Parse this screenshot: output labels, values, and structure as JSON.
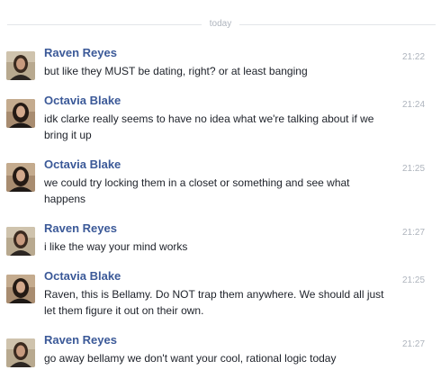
{
  "divider": {
    "label": "today"
  },
  "messages": [
    {
      "sender": "Raven Reyes",
      "avatar": "raven-avatar",
      "time": "21:22",
      "text": "but like they MUST be dating, right? or at least banging"
    },
    {
      "sender": "Octavia Blake",
      "avatar": "octavia-avatar",
      "time": "21:24",
      "text": "idk clarke really seems to have no idea what we're talking about if we bring it up"
    },
    {
      "sender": "Octavia Blake",
      "avatar": "octavia-avatar",
      "time": "21:25",
      "text": "we could try locking them in a closet or something and see what happens"
    },
    {
      "sender": "Raven Reyes",
      "avatar": "raven-avatar",
      "time": "21:27",
      "text": "i like the way your mind works"
    },
    {
      "sender": "Octavia Blake",
      "avatar": "octavia-avatar",
      "time": "21:25",
      "text": "Raven, this is Bellamy. Do NOT trap them anywhere. We should all just let them figure it out on their own."
    },
    {
      "sender": "Raven Reyes",
      "avatar": "raven-avatar",
      "time": "21:27",
      "text": "go away bellamy we don't want your cool, rational logic today"
    }
  ]
}
